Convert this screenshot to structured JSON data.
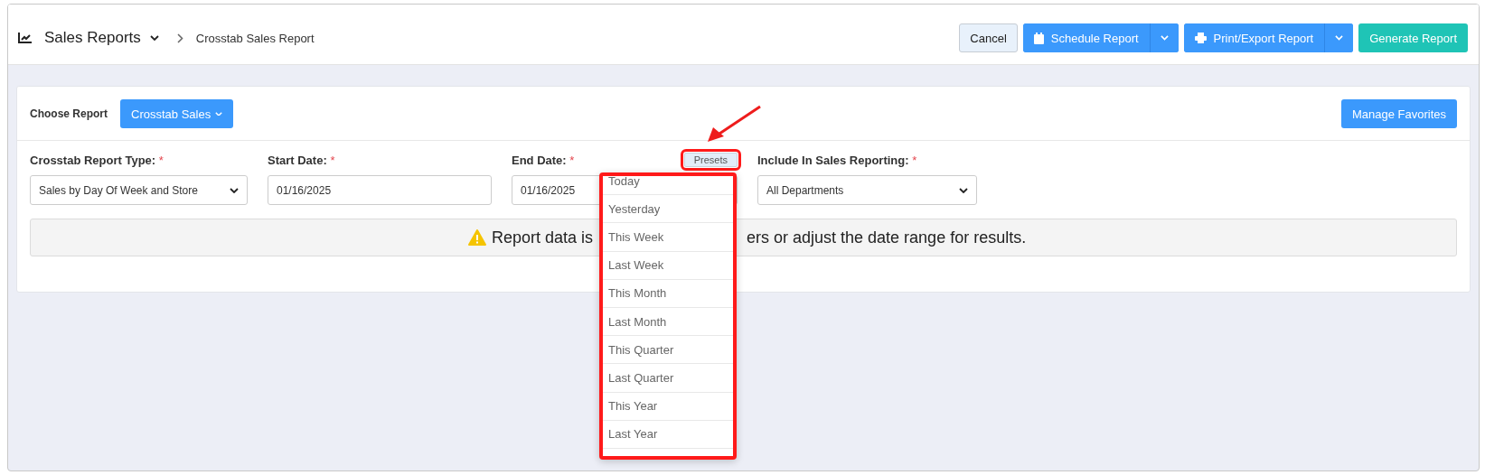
{
  "header": {
    "section": "Sales Reports",
    "breadcrumb": "Crosstab Sales Report",
    "buttons": [
      {
        "kind": "plain",
        "label": "Cancel"
      },
      {
        "kind": "split",
        "label": "Schedule Report"
      },
      {
        "kind": "split",
        "label": "Print/Export Report"
      },
      {
        "kind": "primary",
        "label": "Generate Report"
      }
    ]
  },
  "toolbar": {
    "choose_label": "Choose Report",
    "report_button": "Crosstab Sales",
    "favorites_button": "Manage Favorites"
  },
  "filters": [
    {
      "kind": "select",
      "label": "Crosstab Report Type:",
      "required_mark": "*",
      "value": "Sales by Day Of Week and Store"
    },
    {
      "kind": "date",
      "label": "Start Date:",
      "required_mark": "*",
      "value": "01/16/2025"
    },
    {
      "kind": "date",
      "label": "End Date:",
      "required_mark": "*",
      "value": "01/16/2025",
      "presets_button": "Presets",
      "presets_open": true
    },
    {
      "kind": "select",
      "label": "Include In Sales Reporting:",
      "required_mark": "*",
      "value": "All Departments"
    }
  ],
  "alert": {
    "text_before": "Report data is",
    "text_after": "ers or adjust the date range for results."
  },
  "presets_menu": [
    "Today",
    "Yesterday",
    "This Week",
    "Last Week",
    "This Month",
    "Last Month",
    "This Quarter",
    "Last Quarter",
    "This Year",
    "Last Year"
  ]
}
